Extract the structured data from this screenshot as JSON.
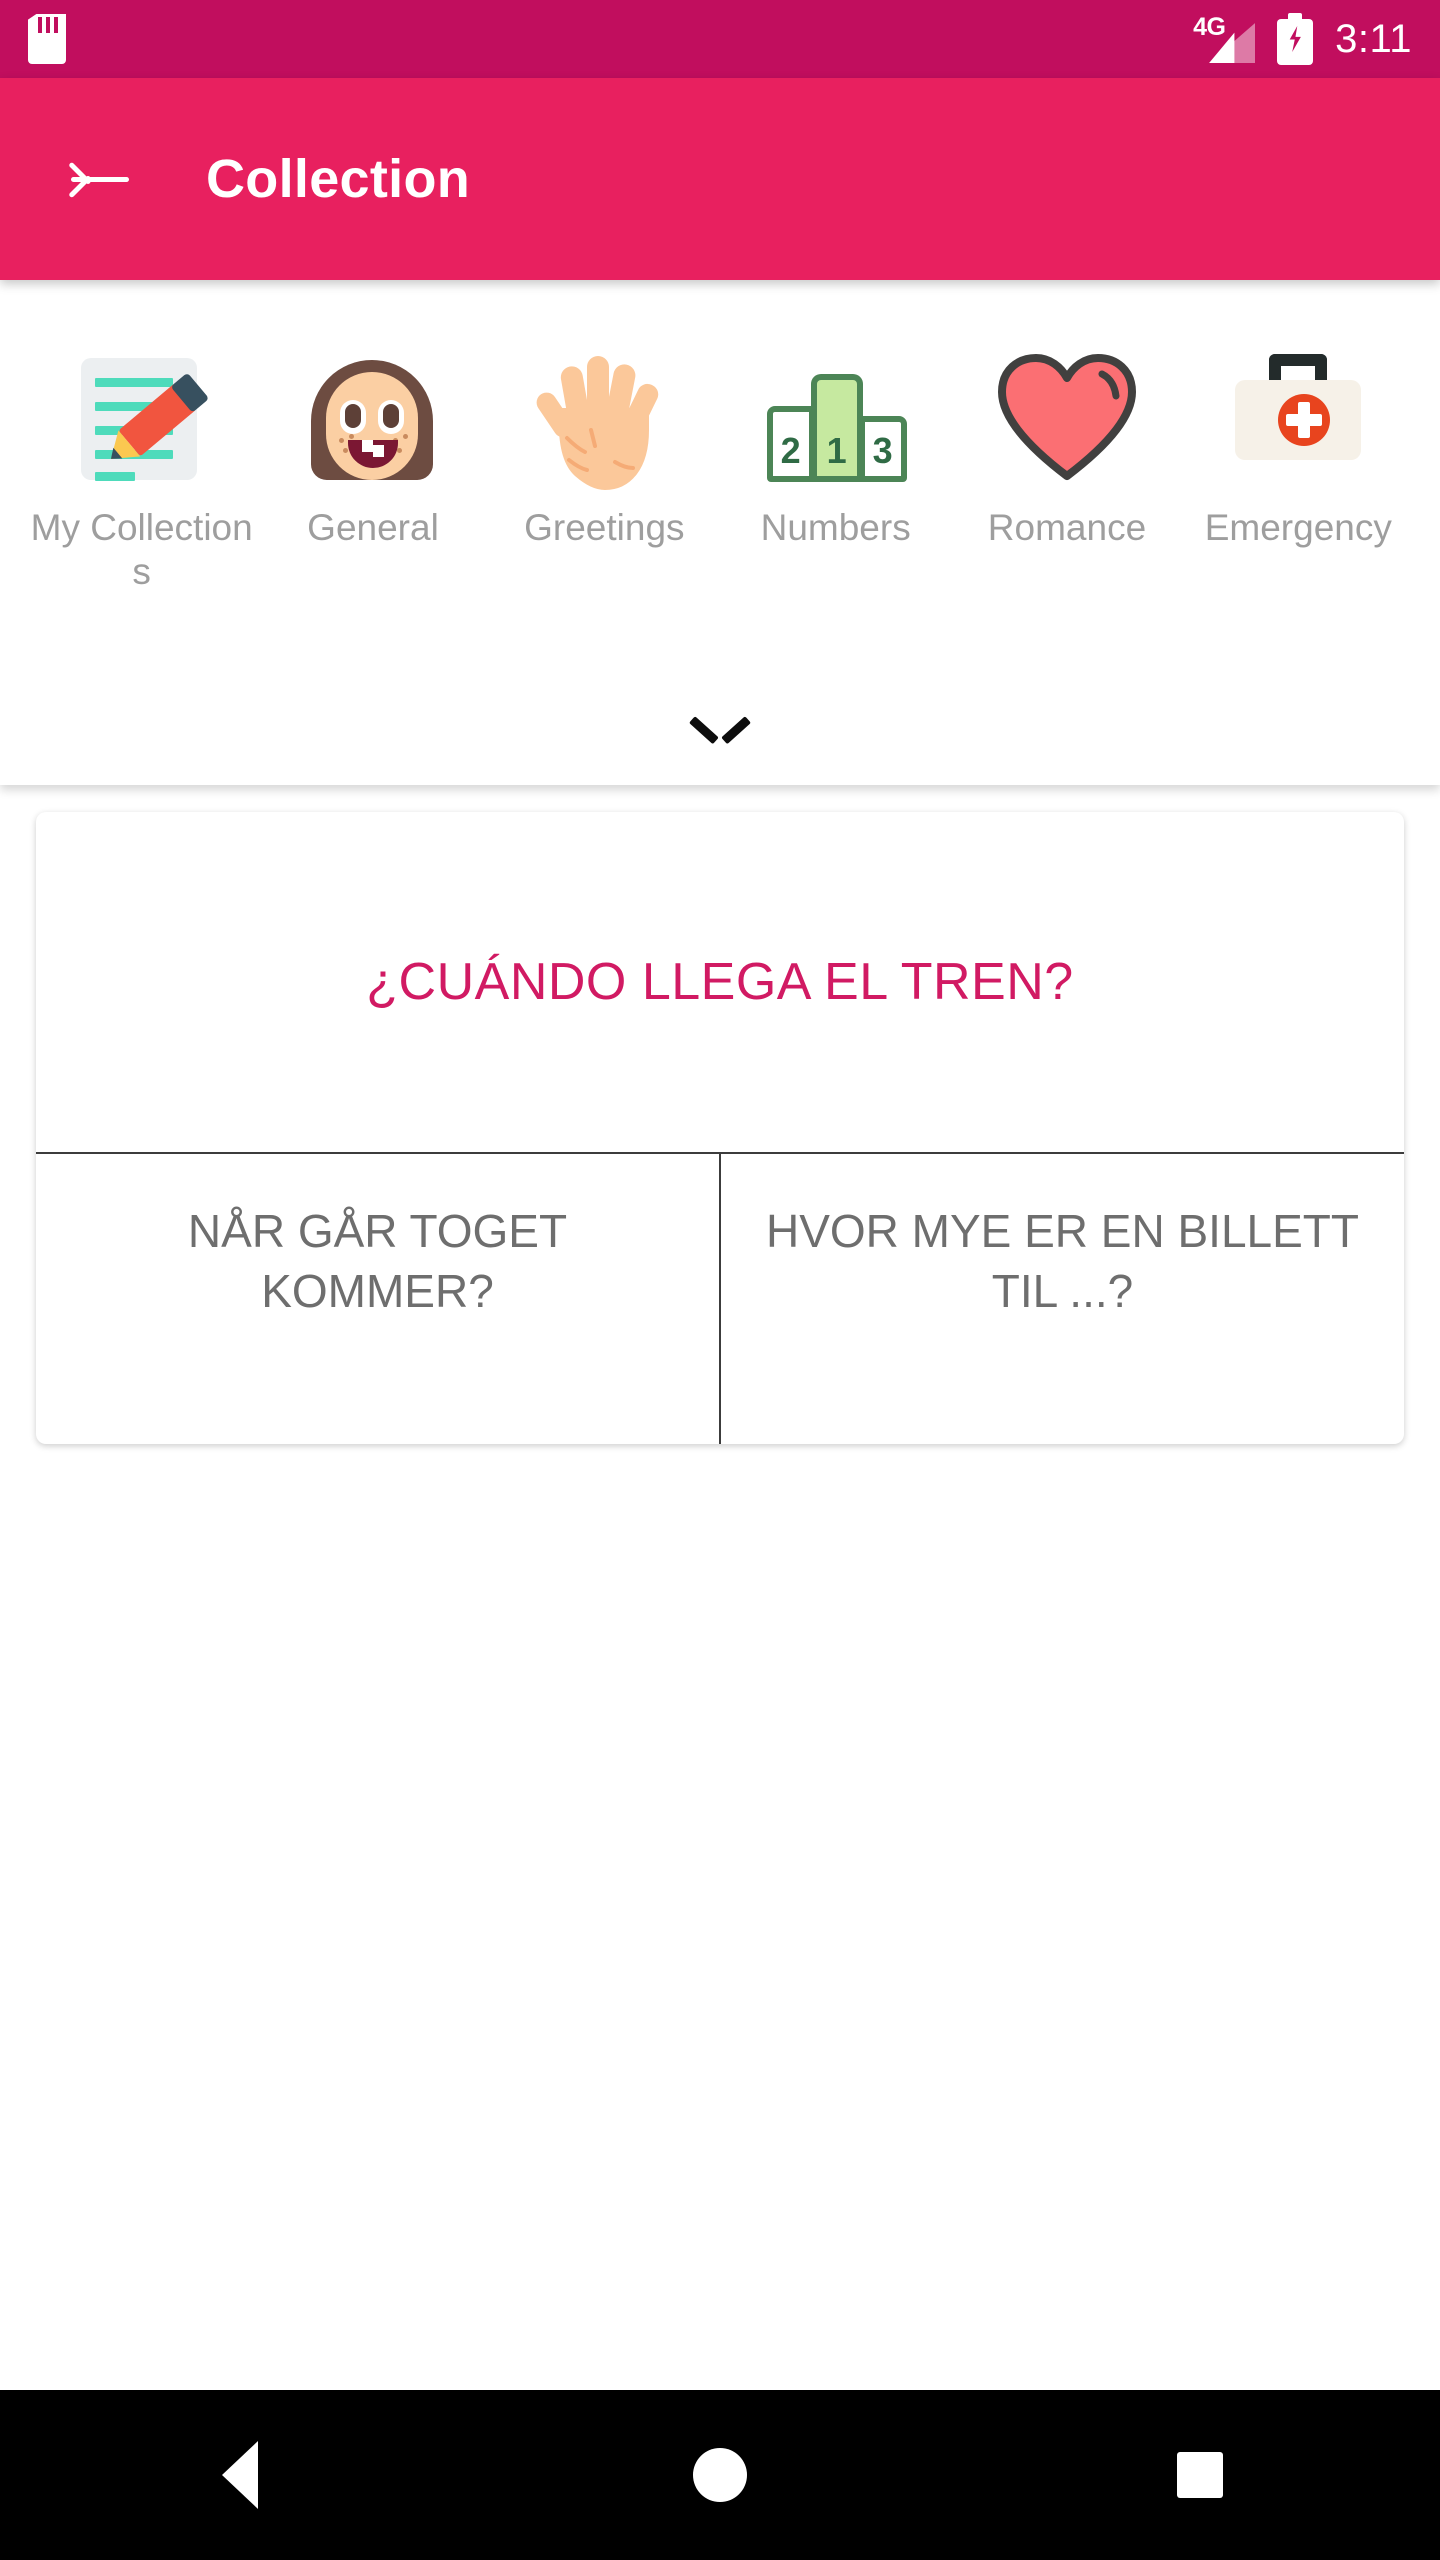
{
  "statusbar": {
    "sdcard_icon": "sd-card-icon",
    "network_label": "4G",
    "signal_icon": "signal-bars-icon",
    "battery_icon": "battery-charging-icon",
    "time": "3:11",
    "bg_color": "#c10e5e"
  },
  "appbar": {
    "back_icon": "back-arrow-icon",
    "title": "Collection",
    "bg_color": "#e8205f"
  },
  "categories": {
    "expand_icon": "chevron-down-icon",
    "items": [
      {
        "label": "My Collections",
        "icon": "memo-pencil-icon"
      },
      {
        "label": "General",
        "icon": "girl-face-icon"
      },
      {
        "label": "Greetings",
        "icon": "open-hand-icon"
      },
      {
        "label": "Numbers",
        "icon": "podium-123-icon"
      },
      {
        "label": "Romance",
        "icon": "heart-icon"
      },
      {
        "label": "Emergency",
        "icon": "first-aid-kit-icon"
      }
    ]
  },
  "phrase_card": {
    "main_phrase": "¿CUÁNDO LLEGA EL TREN?",
    "main_phrase_color": "#d11a63",
    "options": [
      {
        "text": "NÅR GÅR TOGET KOMMER?"
      },
      {
        "text": "HVOR MYE ER EN BILLETT TIL ...?"
      }
    ]
  },
  "navbar": {
    "back": "nav-back-triangle-icon",
    "home": "nav-home-circle-icon",
    "recents": "nav-recents-square-icon"
  }
}
